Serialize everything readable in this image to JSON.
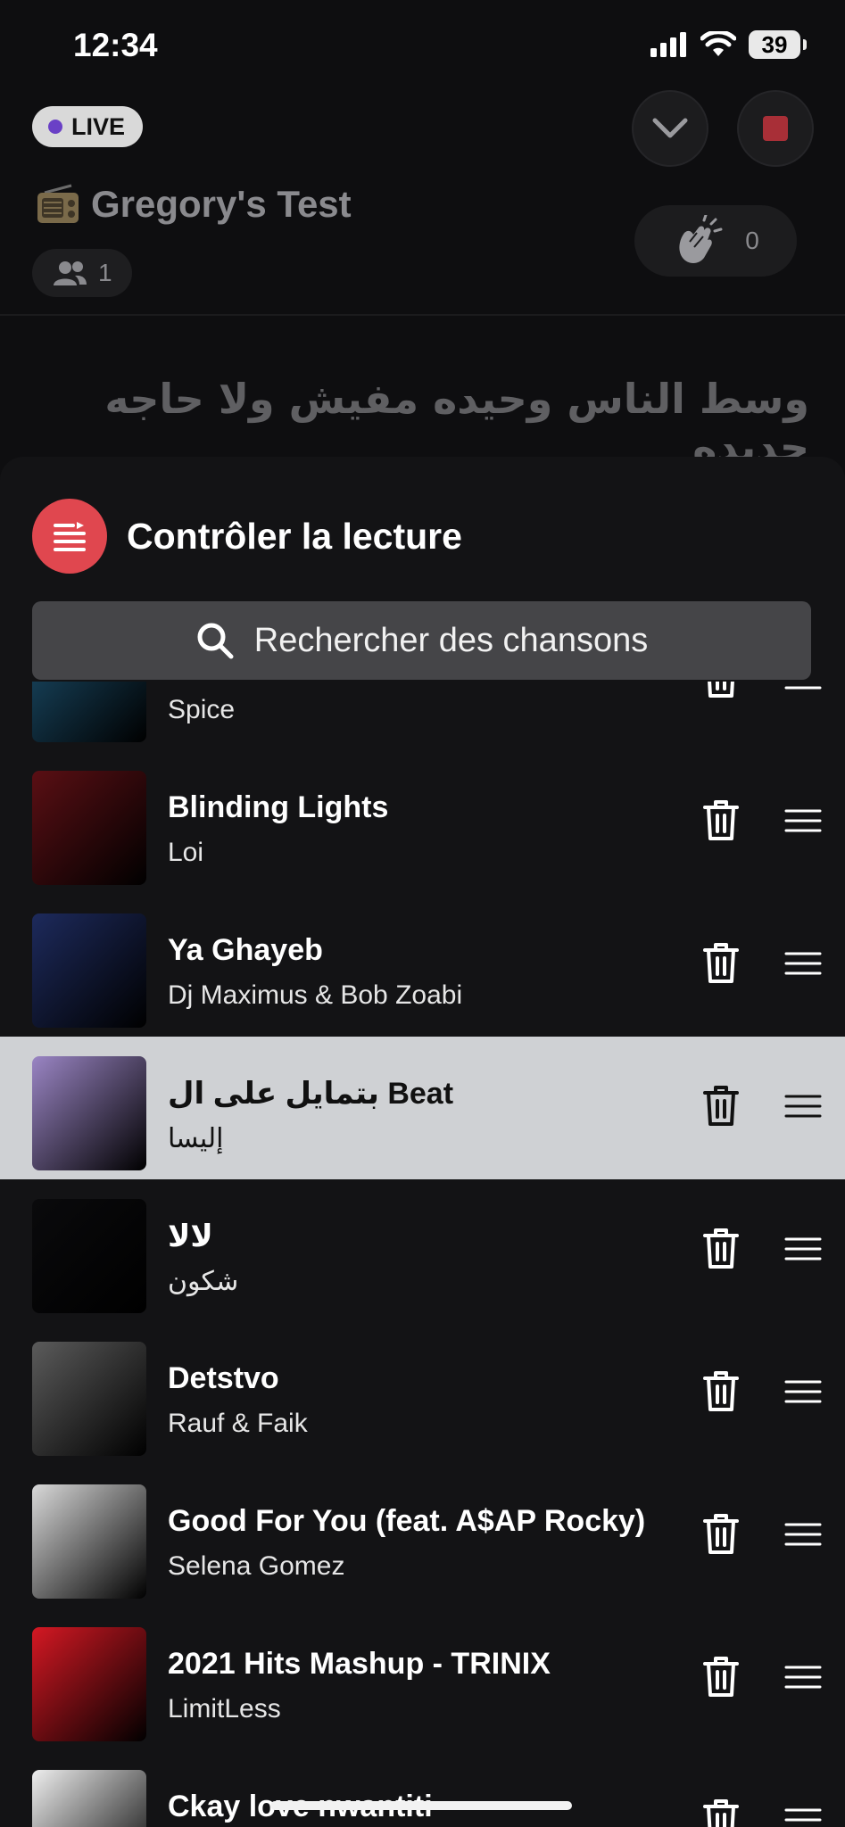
{
  "status_bar": {
    "time": "12:34",
    "battery": "39"
  },
  "room": {
    "live_label": "LIVE",
    "title": "Gregory's Test",
    "listeners_count": "1",
    "claps_count": "0",
    "lyrics": "وسط الناس  وحيده مفيش ولا حاجه جديده"
  },
  "sheet": {
    "title": "Contrôler la lecture",
    "search_placeholder": "Rechercher des chansons"
  },
  "tracks": [
    {
      "title": "",
      "artist": "Spice",
      "art_color": "#1b4e6b"
    },
    {
      "title": "Blinding Lights",
      "artist": "Loi",
      "art_color": "#5a0f14"
    },
    {
      "title": "Ya Ghayeb",
      "artist": "Dj Maximus & Bob Zoabi",
      "art_color": "#1d2a5c"
    },
    {
      "title": "بتمايل على ال Beat",
      "artist": "إليسا",
      "art_color": "#9a85c4",
      "selected": true
    },
    {
      "title": "لالا",
      "artist": "شكون",
      "art_color": "#0a0a0c"
    },
    {
      "title": "Detstvo",
      "artist": "Rauf & Faik",
      "art_color": "#5b5b5b"
    },
    {
      "title": "Good For You (feat. A$AP Rocky)",
      "artist": "Selena Gomez",
      "art_color": "#d9d9d9"
    },
    {
      "title": "2021 Hits Mashup - TRINIX",
      "artist": "LimitLess",
      "art_color": "#d41823"
    },
    {
      "title": "Ckay love nwantiti",
      "artist": "",
      "art_color": "#eeeeee"
    }
  ],
  "colors": {
    "accent_red": "#e0474f",
    "stop_red": "#a82f37",
    "live_dot": "#6a40c6",
    "highlight_row": "#cfd1d4"
  }
}
